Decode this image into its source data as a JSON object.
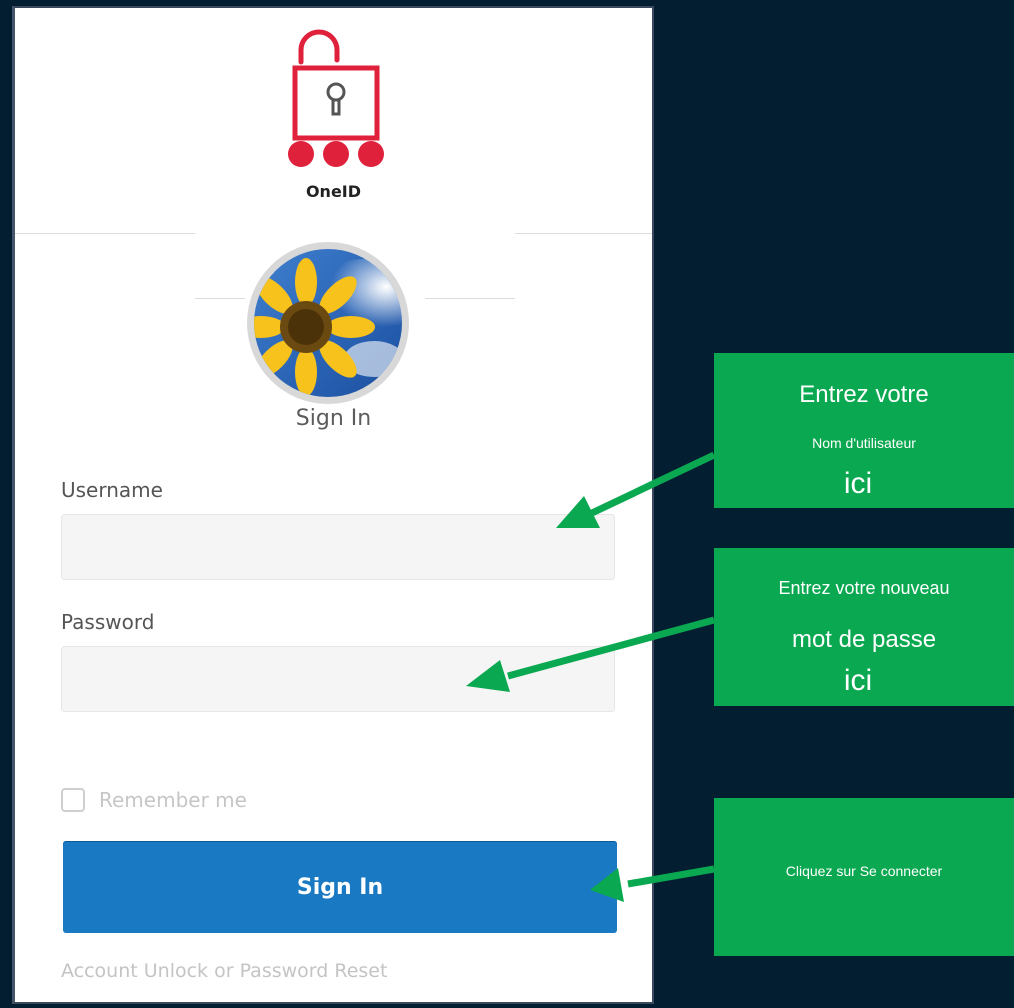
{
  "login": {
    "brand": "OneID",
    "heading": "Sign In",
    "username_label": "Username",
    "username_value": "",
    "username_placeholder": "",
    "password_label": "Password",
    "password_value": "",
    "remember_label": "Remember me",
    "remember_checked": false,
    "submit_label": "Sign In",
    "reset_link": "Account Unlock or Password Reset"
  },
  "callouts": {
    "username": {
      "line1": "Entrez votre",
      "line2": "Nom d'utilisateur",
      "line3": "ici"
    },
    "password": {
      "line1": "Entrez votre nouveau",
      "line2": "mot de passe",
      "line3": "ici"
    },
    "signin": {
      "text": "Cliquez sur Se connecter"
    }
  },
  "icons": {
    "logo": "padlock-three-dots-icon",
    "avatar": "sunflower-avatar"
  },
  "colors": {
    "background": "#031d31",
    "brand_red": "#e0213b",
    "callout_green": "#0aa850",
    "arrow_green": "#0aa850",
    "primary_button": "#1979c3"
  }
}
